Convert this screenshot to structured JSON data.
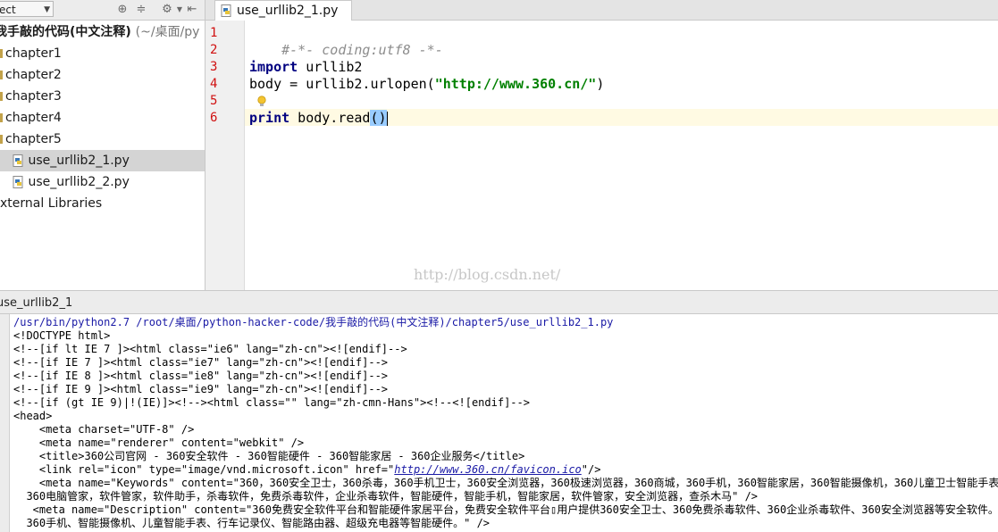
{
  "project_panel": {
    "selector_label": "ect",
    "root_name": "我手敲的代码(中文注释)",
    "root_path": "(~/桌面/py",
    "items": [
      {
        "label": "chapter1",
        "type": "folder"
      },
      {
        "label": "chapter2",
        "type": "folder"
      },
      {
        "label": "chapter3",
        "type": "folder"
      },
      {
        "label": "chapter4",
        "type": "folder"
      },
      {
        "label": "chapter5",
        "type": "folder"
      },
      {
        "label": "use_urllib2_1.py",
        "type": "python-file",
        "selected": true
      },
      {
        "label": "use_urllib2_2.py",
        "type": "python-file"
      },
      {
        "label": "xternal Libraries",
        "type": "library"
      }
    ]
  },
  "editor": {
    "tab_label": "use_urllib2_1.py",
    "line_numbers": [
      "1",
      "2",
      "3",
      "4",
      "5",
      "6"
    ],
    "lines": {
      "l1_comment": "#-*- coding:utf8 -*-",
      "l3_kw": "import",
      "l3_rest": " urllib2",
      "l4_a": "body = urllib2.urlopen(",
      "l4_str": "\"http://www.360.cn/\"",
      "l4_b": ")",
      "l6_kw": "print",
      "l6_rest": " body.read",
      "l6_paren": "()"
    },
    "watermark": "http://blog.csdn.net/"
  },
  "run_panel": {
    "tab_label": "use_urllib2_1",
    "path_line": "/usr/bin/python2.7 /root/桌面/python-hacker-code/我手敲的代码(中文注释)/chapter5/use_urllib2_1.py",
    "lines": [
      "<!DOCTYPE html>",
      "<!--[if lt IE 7 ]><html class=\"ie6\" lang=\"zh-cn\"><![endif]-->",
      "<!--[if IE 7 ]><html class=\"ie7\" lang=\"zh-cn\"><![endif]-->",
      "<!--[if IE 8 ]><html class=\"ie8\" lang=\"zh-cn\"><![endif]-->",
      "<!--[if IE 9 ]><html class=\"ie9\" lang=\"zh-cn\"><![endif]-->",
      "<!--[if (gt IE 9)|!(IE)]><!--><html class=\"\" lang=\"zh-cmn-Hans\"><!--<![endif]-->",
      "<head>",
      "    <meta charset=\"UTF-8\" />",
      "    <meta name=\"renderer\" content=\"webkit\" />",
      "    <title>360公司官网 - 360安全软件 - 360智能硬件 - 360智能家居 - 360企业服务</title>"
    ],
    "link_line": {
      "before": "    <link rel=\"icon\" type=\"image/vnd.microsoft.icon\" href=\"",
      "link": "http://www.360.cn/favicon.ico",
      "after": "\"/>"
    },
    "lines2": [
      "    <meta name=\"Keywords\" content=\"360，360安全卫士，360杀毒，360手机卫士，360安全浏览器，360极速浏览器，360商城，360手机，360智能家居，360智能摄像机，360儿童卫士智能手表，3",
      "  360电脑管家，软件管家，软件助手，杀毒软件，免费杀毒软件，企业杀毒软件，智能硬件，智能手机，智能家居，软件管家，安全浏览器，查杀木马\" />",
      "   <meta name=\"Description\" content=\"360免费安全软件平台和智能硬件家居平台，免费安全软件平台▯用户提供360安全卫士、360免费杀毒软件、360企业杀毒软件、360安全浏览器等安全软件。智能",
      "  360手机、智能摄像机、儿童智能手表、行车记录仪、智能路由器、超级充电器等智能硬件。\" />"
    ]
  }
}
